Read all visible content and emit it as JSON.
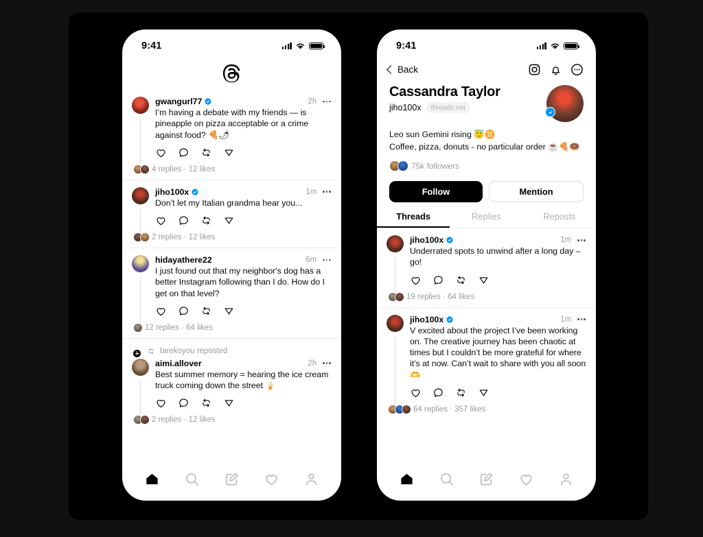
{
  "status_bar": {
    "time": "9:41",
    "signal_icon": "cellular-signal-icon",
    "wifi_icon": "wifi-icon",
    "battery_icon": "battery-icon"
  },
  "phone_left": {
    "app_logo": "threads-logo",
    "posts": [
      {
        "username": "gwangurl77",
        "verified": true,
        "time": "2h",
        "text": "I’m having a debate with my friends — is pineapple on pizza acceptable or a crime against food? 🍕🌶",
        "stats": "4 replies · 12 likes",
        "avatar_style": "a-red",
        "mini_avatars": [
          "m1",
          "m2"
        ]
      },
      {
        "username": "jiho100x",
        "verified": true,
        "time": "1m",
        "text": "Don’t let my Italian grandma hear you...",
        "stats": "2 replies · 12 likes",
        "avatar_style": "a-dark",
        "mini_avatars": [
          "m2",
          "m1"
        ]
      },
      {
        "username": "hidayathere22",
        "verified": false,
        "time": "6m",
        "text": "I just found out that my neighbor's dog has a better Instagram following than I do. How do I get on that level?",
        "stats": "12 replies · 64 likes",
        "avatar_style": "a-purp",
        "mini_avatars": [
          "m4"
        ]
      },
      {
        "repost_label": "tarekoyou reposted",
        "username": "aimi.allover",
        "verified": false,
        "time": "2h",
        "text": "Best summer memory = hearing the ice cream truck coming down the street 🍦",
        "stats": "2 replies · 12 likes",
        "avatar_style": "a-brown",
        "has_plus_badge": true,
        "mini_avatars": [
          "m4",
          "m2"
        ]
      }
    ],
    "tabbar": [
      {
        "name": "home-icon",
        "label": "Home",
        "active": true
      },
      {
        "name": "search-icon",
        "label": "Search",
        "active": false
      },
      {
        "name": "compose-icon",
        "label": "Compose",
        "active": false
      },
      {
        "name": "heart-icon",
        "label": "Activity",
        "active": false
      },
      {
        "name": "profile-icon",
        "label": "Profile",
        "active": false
      }
    ],
    "post_actions": [
      {
        "name": "like-icon",
        "label": "Like"
      },
      {
        "name": "comment-icon",
        "label": "Reply"
      },
      {
        "name": "repost-icon",
        "label": "Repost"
      },
      {
        "name": "share-icon",
        "label": "Share"
      }
    ]
  },
  "phone_right": {
    "back_label": "Back",
    "nav_icons": [
      {
        "name": "instagram-icon",
        "label": "Instagram"
      },
      {
        "name": "bell-icon",
        "label": "Notifications"
      },
      {
        "name": "more-circle-icon",
        "label": "More"
      }
    ],
    "profile": {
      "display_name": "Cassandra Taylor",
      "handle": "jiho100x",
      "domain_pill": "threads.net",
      "bio_line_1": "Leo sun Gemini rising 😇♊",
      "bio_line_2": "Coffee, pizza, donuts - no particular order ☕🍕🍩",
      "followers": "75k followers",
      "verified": true
    },
    "buttons": {
      "follow": "Follow",
      "mention": "Mention"
    },
    "tabs": [
      {
        "label": "Threads",
        "active": true
      },
      {
        "label": "Replies",
        "active": false
      },
      {
        "label": "Reposts",
        "active": false
      }
    ],
    "posts": [
      {
        "username": "jiho100x",
        "verified": true,
        "time": "1m",
        "text": "Underrated spots to unwind after a long day – go!",
        "stats": "19 replies · 64 likes",
        "avatar_style": "a-dark",
        "mini_avatars": [
          "m4",
          "m2"
        ]
      },
      {
        "username": "jiho100x",
        "verified": true,
        "time": "1m",
        "text": "V excited about the project I’ve been working on. The creative journey has been chaotic at times but I couldn’t be more grateful for where it’s at now. Can’t wait to share with you all soon 🫶",
        "stats": "64 replies · 357 likes",
        "avatar_style": "a-dark",
        "mini_avatars": [
          "m1",
          "m5",
          "m2"
        ]
      }
    ],
    "tabbar": [
      {
        "name": "home-icon",
        "label": "Home",
        "active": true
      },
      {
        "name": "search-icon",
        "label": "Search",
        "active": false
      },
      {
        "name": "compose-icon",
        "label": "Compose",
        "active": false
      },
      {
        "name": "heart-icon",
        "label": "Activity",
        "active": false
      },
      {
        "name": "profile-icon",
        "label": "Profile",
        "active": false
      }
    ]
  },
  "colors": {
    "accent_blue": "#0095f6",
    "background": "#000000",
    "surface": "#ffffff",
    "muted_text": "#9b9b9b"
  }
}
